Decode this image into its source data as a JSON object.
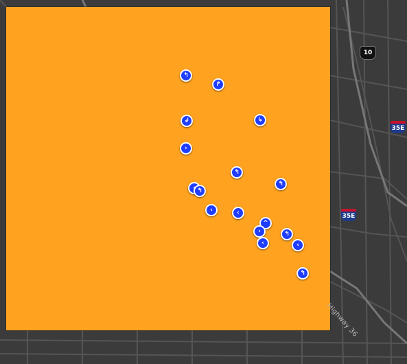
{
  "map": {
    "overlay_color": "#ffa21f",
    "basemap_color": "#3b3b3b",
    "road_color": "#555555",
    "marker_color": "#1f3dff"
  },
  "labels": {
    "us_route": "10",
    "interstate_a": "35E",
    "interstate_b": "35E",
    "highway_label": "Highway 36"
  },
  "markers": [
    {
      "id": "m1",
      "glyph": "↰"
    },
    {
      "id": "m2",
      "glyph": "↱"
    },
    {
      "id": "m3",
      "glyph": "↲"
    },
    {
      "id": "m4",
      "glyph": "↳"
    },
    {
      "id": "m5",
      "glyph": "›"
    },
    {
      "id": "m6",
      "glyph": "↰"
    },
    {
      "id": "m7",
      "glyph": "↰"
    },
    {
      "id": "m8",
      "glyph": "‹"
    },
    {
      "id": "m9",
      "glyph": "↰"
    },
    {
      "id": "m10",
      "glyph": "‹"
    },
    {
      "id": "m11",
      "glyph": "‹"
    },
    {
      "id": "m12",
      "glyph": "^"
    },
    {
      "id": "m13",
      "glyph": "›"
    },
    {
      "id": "m14",
      "glyph": "↰"
    },
    {
      "id": "m15",
      "glyph": "‹"
    },
    {
      "id": "m16",
      "glyph": "‹"
    },
    {
      "id": "m17",
      "glyph": "↰"
    }
  ]
}
